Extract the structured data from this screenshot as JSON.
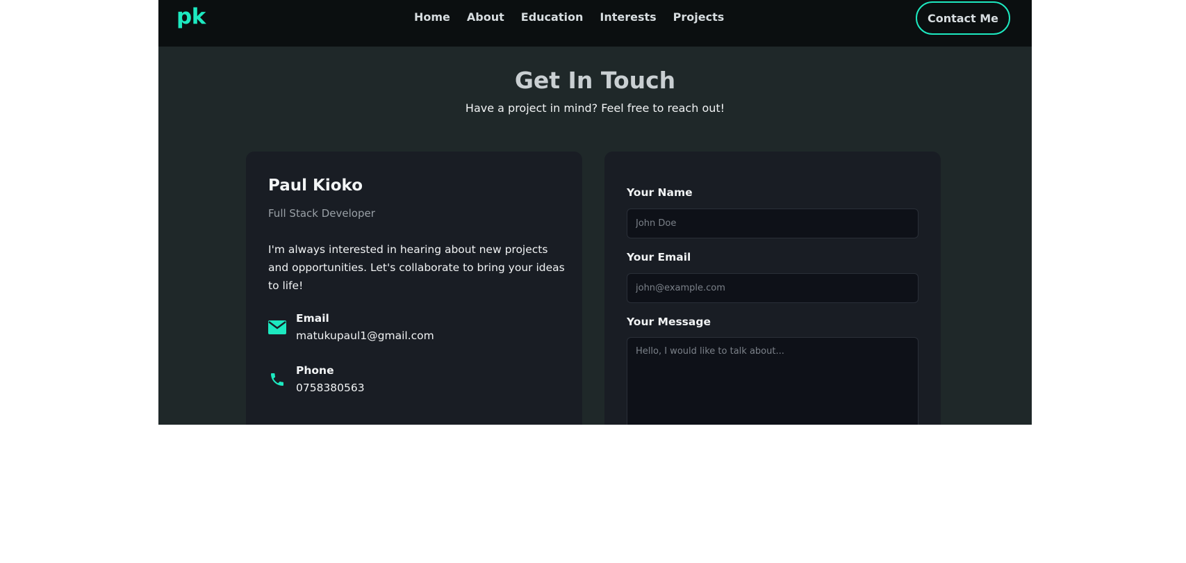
{
  "header": {
    "logo": "pk",
    "nav": [
      "Home",
      "About",
      "Education",
      "Interests",
      "Projects"
    ],
    "cta": "Contact Me"
  },
  "section": {
    "title": "Get In Touch",
    "subtitle": "Have a project in mind? Feel free to reach out!"
  },
  "info": {
    "name": "Paul Kioko",
    "role": "Full Stack Developer",
    "bio": "I'm always interested in hearing about new projects and opportunities. Let's collaborate to bring your ideas to life!",
    "email_label": "Email",
    "email_value": "matukupaul1@gmail.com",
    "email_icon": "envelope-icon",
    "phone_label": "Phone",
    "phone_value": "0758380563",
    "phone_icon": "phone-icon"
  },
  "form": {
    "name_label": "Your Name",
    "name_placeholder": "John Doe",
    "email_label": "Your Email",
    "email_placeholder": "john@example.com",
    "message_label": "Your Message",
    "message_placeholder": "Hello, I would like to talk about..."
  },
  "colors": {
    "accent": "#1de9c0",
    "nav_bg": "#0b0f10",
    "section_bg": "#1f2829",
    "card_bg": "#191d24",
    "input_bg": "#0e1118"
  }
}
